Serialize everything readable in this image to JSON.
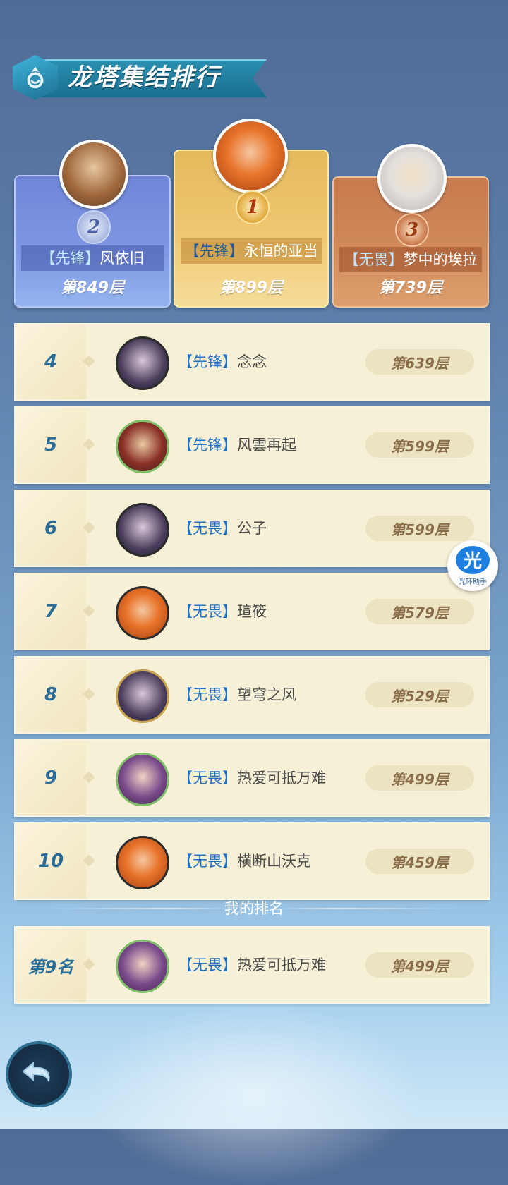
{
  "title": "龙塔集结排行",
  "podium": [
    {
      "rank": "2",
      "tag": "【先锋】",
      "name": "风依旧",
      "floor": "第849层"
    },
    {
      "rank": "1",
      "tag": "【先锋】",
      "name": "永恒的亚当",
      "floor": "第899层"
    },
    {
      "rank": "3",
      "tag": "【无畏】",
      "name": "梦中的埃拉",
      "floor": "第739层"
    }
  ],
  "rows": [
    {
      "rank": "4",
      "tag": "【先锋】",
      "name": "念念",
      "floor": "第639层"
    },
    {
      "rank": "5",
      "tag": "【先锋】",
      "name": "风雲再起",
      "floor": "第599层"
    },
    {
      "rank": "6",
      "tag": "【无畏】",
      "name": "公子",
      "floor": "第599层"
    },
    {
      "rank": "7",
      "tag": "【无畏】",
      "name": "瑄筱",
      "floor": "第579层"
    },
    {
      "rank": "8",
      "tag": "【无畏】",
      "name": "望穹之风",
      "floor": "第529层"
    },
    {
      "rank": "9",
      "tag": "【无畏】",
      "name": "热爱可抵万难",
      "floor": "第499层"
    },
    {
      "rank": "10",
      "tag": "【无畏】",
      "name": "横断山沃克",
      "floor": "第459层"
    }
  ],
  "my_rank": {
    "label": "我的排名",
    "rank": "第9名",
    "tag": "【无畏】",
    "name": "热爱可抵万难",
    "floor": "第499层"
  },
  "helper": {
    "glyph": "光",
    "label": "光环助手"
  },
  "icons": {
    "title_emblem": "dragon-emblem-icon",
    "back": "back-arrow-icon"
  },
  "colors": {
    "accent_blue": "#1f71c8",
    "rank_number": "#2a6c98",
    "gold": "#e6b85c",
    "silver": "#7f98e3",
    "bronze": "#d08a5a"
  }
}
